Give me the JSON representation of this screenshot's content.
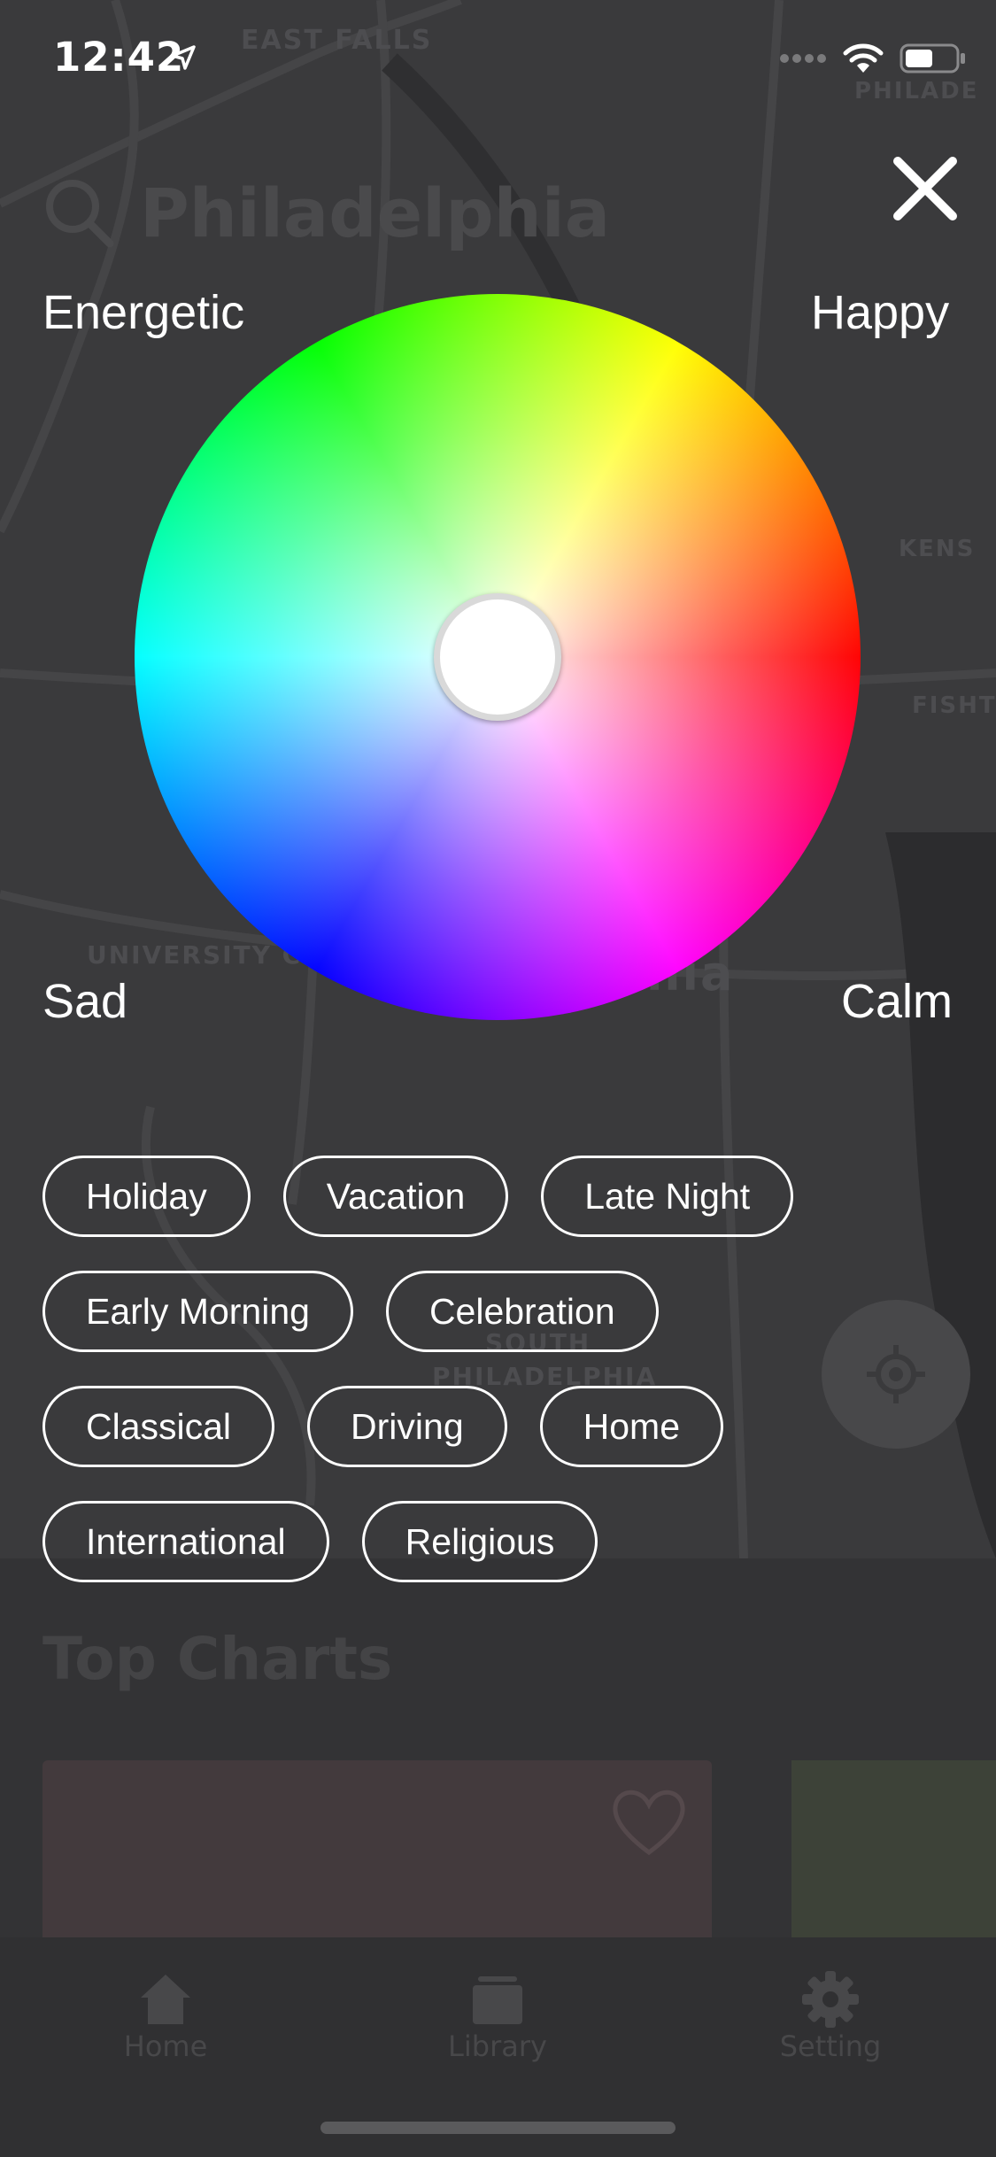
{
  "status_bar": {
    "time": "12:42",
    "location_icon": "location-arrow-icon",
    "signal_icon": "cellular-dots-icon",
    "wifi_icon": "wifi-icon",
    "battery_icon": "battery-icon"
  },
  "background": {
    "search_title": "Philadelphia",
    "map_labels": [
      "EAST FALLS",
      "PHILADE",
      "KENS",
      "FISHT",
      "UNIVERSITY C",
      "hia",
      "SOUTH",
      "PHILADELPHIA"
    ],
    "sheet_title": "Top Charts",
    "tabs": [
      {
        "label": "Home",
        "icon": "home-icon"
      },
      {
        "label": "Library",
        "icon": "library-icon"
      },
      {
        "label": "Setting",
        "icon": "gear-icon"
      }
    ]
  },
  "mood_picker": {
    "close_icon": "close-icon",
    "labels": {
      "top_left": "Energetic",
      "top_right": "Happy",
      "bottom_left": "Sad",
      "bottom_right": "Calm"
    },
    "tags": [
      [
        "Holiday",
        "Vacation",
        "Late Night"
      ],
      [
        "Early Morning",
        "Celebration"
      ],
      [
        "Classical",
        "Driving",
        "Home"
      ],
      [
        "International",
        "Religious"
      ]
    ]
  },
  "colors": {
    "overlay_bg": "#333335",
    "text": "#ffffff",
    "knob_border": "#d9d9d9"
  }
}
